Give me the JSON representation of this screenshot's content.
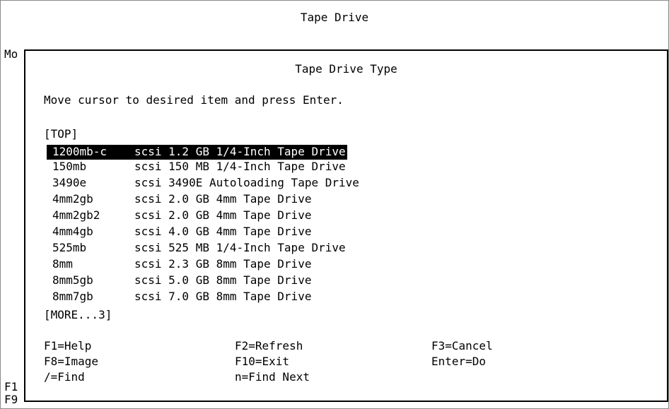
{
  "window": {
    "title": "Tape Drive"
  },
  "background_fragments": {
    "mo": "Mo",
    "f1": "F1",
    "f9": "F9"
  },
  "dialog": {
    "title": "Tape Drive Type",
    "instruction": "Move cursor to desired item and press Enter.",
    "top_marker": "[TOP]",
    "more_marker": "[MORE...3]",
    "items": [
      {
        "code": "1200mb-c",
        "desc": "scsi 1.2 GB 1/4-Inch Tape Drive",
        "selected": true
      },
      {
        "code": "150mb",
        "desc": "scsi 150 MB 1/4-Inch Tape Drive",
        "selected": false
      },
      {
        "code": "3490e",
        "desc": "scsi 3490E Autoloading Tape Drive",
        "selected": false
      },
      {
        "code": "4mm2gb",
        "desc": "scsi 2.0 GB 4mm Tape Drive",
        "selected": false
      },
      {
        "code": "4mm2gb2",
        "desc": "scsi 2.0 GB 4mm Tape Drive",
        "selected": false
      },
      {
        "code": "4mm4gb",
        "desc": "scsi 4.0 GB 4mm Tape Drive",
        "selected": false
      },
      {
        "code": "525mb",
        "desc": "scsi 525 MB 1/4-Inch Tape Drive",
        "selected": false
      },
      {
        "code": "8mm",
        "desc": "scsi 2.3 GB 8mm Tape Drive",
        "selected": false
      },
      {
        "code": "8mm5gb",
        "desc": "scsi 5.0 GB 8mm Tape Drive",
        "selected": false
      },
      {
        "code": "8mm7gb",
        "desc": "scsi 7.0 GB 8mm Tape Drive",
        "selected": false
      }
    ],
    "function_keys": {
      "help": "F1=Help",
      "refresh": "F2=Refresh",
      "cancel": "F3=Cancel",
      "image": "F8=Image",
      "exit": "F10=Exit",
      "do": "Enter=Do",
      "find": "/=Find",
      "find_next": "n=Find Next"
    }
  }
}
